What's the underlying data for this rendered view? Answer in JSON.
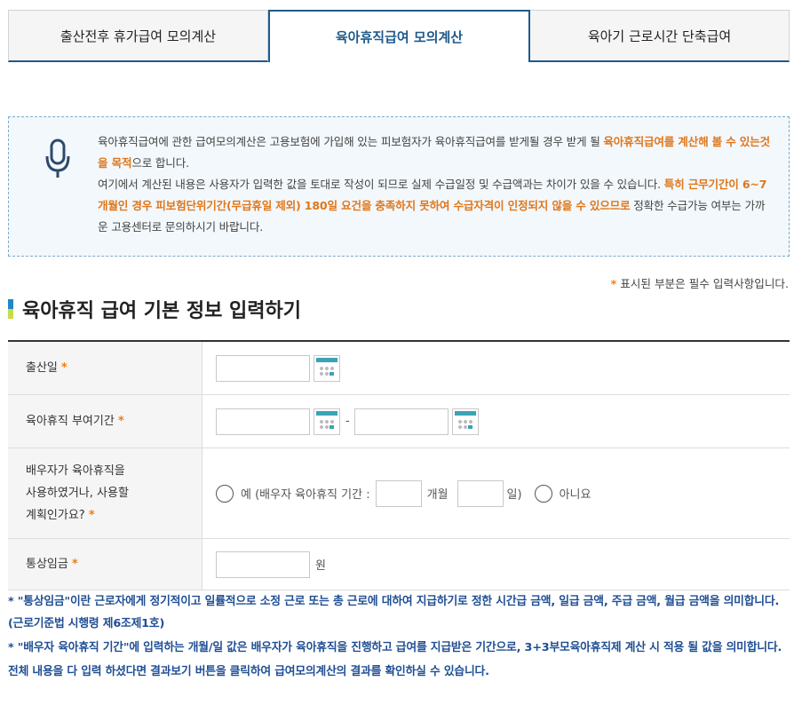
{
  "tabs": [
    {
      "label": "출산전후 휴가급여 모의계산",
      "active": false
    },
    {
      "label": "육아휴직급여 모의계산",
      "active": true
    },
    {
      "label": "육아기 근로시간 단축급여",
      "active": false
    }
  ],
  "info": {
    "icon": "microphone-icon",
    "p1_a": "육아휴직급여에 관한 급여모의계산은 고용보험에 가입해 있는 피보험자가 육아휴직급여를 받게될 경우 받게 될 ",
    "p1_b": "육아휴직급여를 계산해 볼 수 있는것을 목적",
    "p1_c": "으로 합니다.",
    "p2_a": "여기에서 계산된 내용은 사용자가 입력한 값을 토대로 작성이 되므로 실제 수급일정 및 수급액과는 차이가 있을 수 있습니다. ",
    "p2_b": "특히 근무기간이 6~7개월인 경우 피보험단위기간(무급휴일 제외) 180일 요건을 충족하지 못하여 수급자격이 인정되지 않을 수 있으므로",
    "p2_c": " 정확한 수급가능 여부는 가까운 고용센터로 문의하시기 바랍니다."
  },
  "required_note": {
    "star": "*",
    "text": " 표시된 부분은 필수 입력사항입니다."
  },
  "section_title": "육아휴직 급여 기본 정보 입력하기",
  "form": {
    "star": "*",
    "birth_label": "출산일",
    "period_label": "육아휴직 부여기간",
    "period_sep": "-",
    "spouse_label_1": "배우자가 육아휴직을",
    "spouse_label_2": "사용하였거나, 사용할",
    "spouse_label_3": "계획인가요?",
    "yes_text": "예 (배우자 육아휴직 기간 :",
    "months_unit": "개월",
    "days_unit": "일)",
    "no_text": "아니요",
    "wage_label": "통상임금",
    "wage_unit": "원"
  },
  "notes": [
    "* \"통상임금\"이란 근로자에게 정기적이고 일률적으로 소정 근로 또는 총 근로에 대하여 지급하기로 정한 시간급 금액, 일급 금액, 주급 금액, 월급 금액을 의미합니다.(근로기준법 시행령 제6조제1호)",
    "* \"배우자 육아휴직 기간\"에 입력하는 개월/일 값은 배우자가 육아휴직을 진행하고 급여를 지급받은 기간으로, 3+3부모육아휴직제 계산 시 적용 될 값을 의미합니다.",
    "전체 내용을 다 입력 하셨다면 결과보기 버튼을 클릭하여 급여모의계산의 결과를 확인하실 수 있습니다."
  ]
}
